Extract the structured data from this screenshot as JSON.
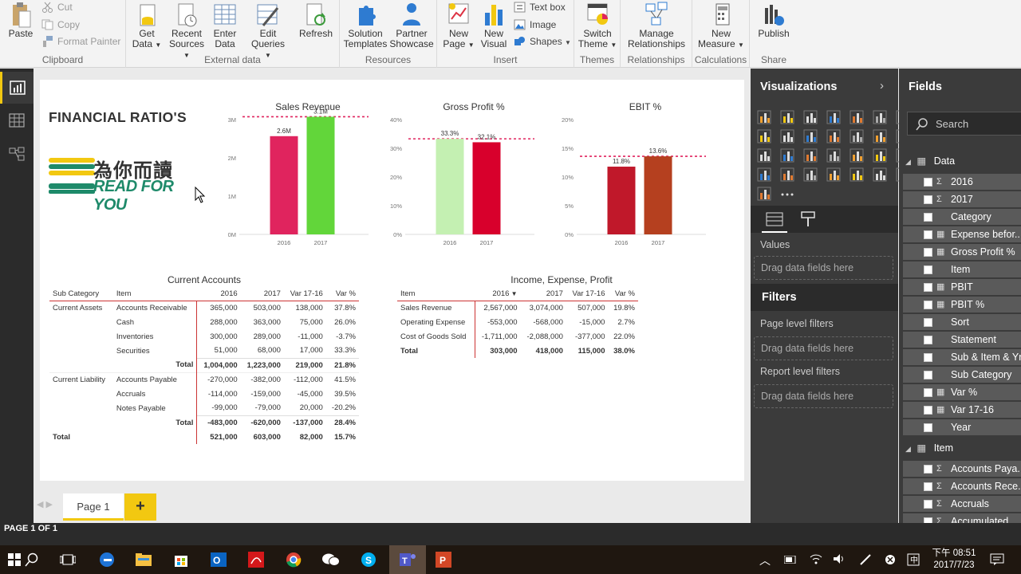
{
  "ribbon": {
    "clipboard": {
      "paste": "Paste",
      "cut": "Cut",
      "copy": "Copy",
      "format_painter": "Format Painter",
      "label": "Clipboard"
    },
    "external": {
      "get_data_1": "Get",
      "get_data_2": "Data",
      "recent_1": "Recent",
      "recent_2": "Sources",
      "enter_1": "Enter",
      "enter_2": "Data",
      "edit_1": "Edit",
      "edit_2": "Queries",
      "refresh": "Refresh",
      "label": "External data"
    },
    "resources": {
      "solution_1": "Solution",
      "solution_2": "Templates",
      "partner_1": "Partner",
      "partner_2": "Showcase",
      "label": "Resources"
    },
    "insert": {
      "new_page_1": "New",
      "new_page_2": "Page",
      "new_visual_1": "New",
      "new_visual_2": "Visual",
      "text_box": "Text box",
      "image": "Image",
      "shapes": "Shapes",
      "label": "Insert"
    },
    "themes": {
      "switch_1": "Switch",
      "switch_2": "Theme",
      "label": "Themes"
    },
    "relationships": {
      "manage_1": "Manage",
      "manage_2": "Relationships",
      "label": "Relationships"
    },
    "calculations": {
      "new_measure_1": "New",
      "new_measure_2": "Measure",
      "label": "Calculations"
    },
    "share": {
      "publish": "Publish",
      "label": "Share"
    }
  },
  "report": {
    "title": "FINANCIAL RATIO'S",
    "logo_cn": "為你而讀",
    "logo_en": "READ FOR YOU"
  },
  "chart_data": [
    {
      "type": "bar",
      "title": "Sales Revenue",
      "categories": [
        "2016",
        "2017"
      ],
      "values": [
        2567000,
        3074000
      ],
      "data_labels": [
        "2.6M",
        "3.1M"
      ],
      "ylim": [
        0,
        3000000
      ],
      "yticks": [
        "0M",
        "1M",
        "2M",
        "3M"
      ],
      "colors": [
        "#e0245e",
        "#62d63a"
      ]
    },
    {
      "type": "bar",
      "title": "Gross Profit %",
      "categories": [
        "2016",
        "2017"
      ],
      "values": [
        33.3,
        32.1
      ],
      "data_labels": [
        "33.3%",
        "32.1%"
      ],
      "ylim": [
        0,
        40
      ],
      "yticks": [
        "0%",
        "10%",
        "20%",
        "30%",
        "40%"
      ],
      "colors": [
        "#c4f0b2",
        "#d8002c"
      ]
    },
    {
      "type": "bar",
      "title": "EBIT %",
      "categories": [
        "2016",
        "2017"
      ],
      "values": [
        11.8,
        13.6
      ],
      "data_labels": [
        "11.8%",
        "13.6%"
      ],
      "ylim": [
        0,
        20
      ],
      "yticks": [
        "0%",
        "5%",
        "10%",
        "15%",
        "20%"
      ],
      "colors": [
        "#c0182a",
        "#b5401f"
      ]
    }
  ],
  "current_accounts": {
    "title": "Current Accounts",
    "headers": [
      "Sub Category",
      "Item",
      "2016",
      "2017",
      "Var 17-16",
      "Var %"
    ],
    "rows": [
      [
        "Current Assets",
        "Accounts Receivable",
        "365,000",
        "503,000",
        "138,000",
        "37.8%"
      ],
      [
        "",
        "Cash",
        "288,000",
        "363,000",
        "75,000",
        "26.0%"
      ],
      [
        "",
        "Inventories",
        "300,000",
        "289,000",
        "-11,000",
        "-3.7%"
      ],
      [
        "",
        "Securities",
        "51,000",
        "68,000",
        "17,000",
        "33.3%"
      ],
      [
        "",
        "Total",
        "1,004,000",
        "1,223,000",
        "219,000",
        "21.8%"
      ],
      [
        "Current Liability",
        "Accounts Payable",
        "-270,000",
        "-382,000",
        "-112,000",
        "41.5%"
      ],
      [
        "",
        "Accruals",
        "-114,000",
        "-159,000",
        "-45,000",
        "39.5%"
      ],
      [
        "",
        "Notes Payable",
        "-99,000",
        "-79,000",
        "20,000",
        "-20.2%"
      ],
      [
        "",
        "Total",
        "-483,000",
        "-620,000",
        "-137,000",
        "28.4%"
      ],
      [
        "Total",
        "",
        "521,000",
        "603,000",
        "82,000",
        "15.7%"
      ]
    ]
  },
  "income": {
    "title": "Income, Expense, Profit",
    "headers": [
      "Item",
      "2016",
      "2017",
      "Var 17-16",
      "Var %"
    ],
    "rows": [
      [
        "Sales Revenue",
        "2,567,000",
        "3,074,000",
        "507,000",
        "19.8%"
      ],
      [
        "Operating Expense",
        "-553,000",
        "-568,000",
        "-15,000",
        "2.7%"
      ],
      [
        "Cost of Goods Sold",
        "-1,711,000",
        "-2,088,000",
        "-377,000",
        "22.0%"
      ],
      [
        "Total",
        "303,000",
        "418,000",
        "115,000",
        "38.0%"
      ]
    ]
  },
  "pages": {
    "tab": "Page 1",
    "add": "+"
  },
  "status": "PAGE 1 OF 1",
  "viz": {
    "title": "Visualizations",
    "values": "Values",
    "drag1": "Drag data fields here",
    "filters": "Filters",
    "page_filters": "Page level filters",
    "drag2": "Drag data fields here",
    "report_filters": "Report level filters",
    "drag3": "Drag data fields here"
  },
  "fields": {
    "title": "Fields",
    "search": "Search",
    "table1": "Data",
    "table1_items": [
      {
        "icon": "Σ",
        "name": "2016"
      },
      {
        "icon": "Σ",
        "name": "2017"
      },
      {
        "icon": "",
        "name": "Category"
      },
      {
        "icon": "▦",
        "name": "Expense befor..."
      },
      {
        "icon": "▦",
        "name": "Gross Profit %"
      },
      {
        "icon": "",
        "name": "Item"
      },
      {
        "icon": "▦",
        "name": "PBIT"
      },
      {
        "icon": "▦",
        "name": "PBIT %"
      },
      {
        "icon": "",
        "name": "Sort"
      },
      {
        "icon": "",
        "name": "Statement"
      },
      {
        "icon": "",
        "name": "Sub & Item & Yr"
      },
      {
        "icon": "",
        "name": "Sub Category"
      },
      {
        "icon": "▦",
        "name": "Var %"
      },
      {
        "icon": "▦",
        "name": "Var 17-16"
      },
      {
        "icon": "",
        "name": "Year"
      }
    ],
    "table2": "Item",
    "table2_items": [
      {
        "icon": "Σ",
        "name": "Accounts Paya..."
      },
      {
        "icon": "Σ",
        "name": "Accounts Rece..."
      },
      {
        "icon": "Σ",
        "name": "Accruals"
      },
      {
        "icon": "Σ",
        "name": "Accumulated"
      }
    ]
  },
  "taskbar": {
    "time": "下午 08:51",
    "date": "2017/7/23"
  },
  "colors": {
    "accent": "#f2c811",
    "dark": "#2b2b2b",
    "panel": "#3b3b3b",
    "ref_line": "#e0245e"
  }
}
